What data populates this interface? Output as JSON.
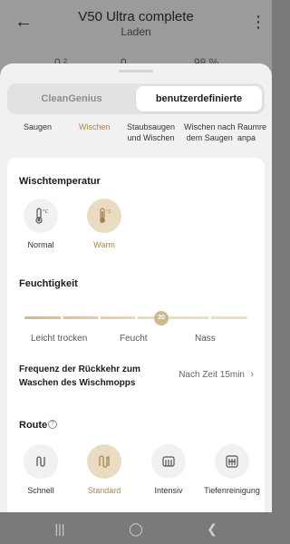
{
  "header": {
    "title": "V50 Ultra complete",
    "subtitle": "Laden",
    "stats": [
      "0 ²",
      "0 ...",
      "98 %"
    ]
  },
  "segments": {
    "clean_genius": "CleanGenius",
    "custom": "benutzerdefinierte"
  },
  "modes": [
    "Saugen",
    "Wischen",
    "Staubsaugen\nund Wischen",
    "Wischen nach\ndem Saugen",
    "Raumre\nanpa"
  ],
  "mop_temperature": {
    "title": "Wischtemperatur",
    "options": [
      {
        "label": "Normal",
        "icon": "thermometer-low-icon",
        "selected": false
      },
      {
        "label": "Warm",
        "icon": "thermometer-high-icon",
        "selected": true
      }
    ]
  },
  "humidity": {
    "title": "Feuchtigkeit",
    "value": "20",
    "labels": [
      "Leicht trocken",
      "Feucht",
      "Nass"
    ]
  },
  "frequency": {
    "title": "Frequenz der Rückkehr zum Waschen des Wischmopps",
    "value": "Nach Zeit 15min"
  },
  "route": {
    "title": "Route",
    "options": [
      {
        "label": "Schnell",
        "icon": "route-fast-icon",
        "selected": false
      },
      {
        "label": "Standard",
        "icon": "route-standard-icon",
        "selected": true
      },
      {
        "label": "Intensiv",
        "icon": "route-intensive-icon",
        "selected": false
      },
      {
        "label": "Tiefenreinigung",
        "icon": "route-deep-icon",
        "selected": false
      }
    ]
  },
  "colors": {
    "accent": "#a38555",
    "accent_bg": "#eadcc2"
  }
}
